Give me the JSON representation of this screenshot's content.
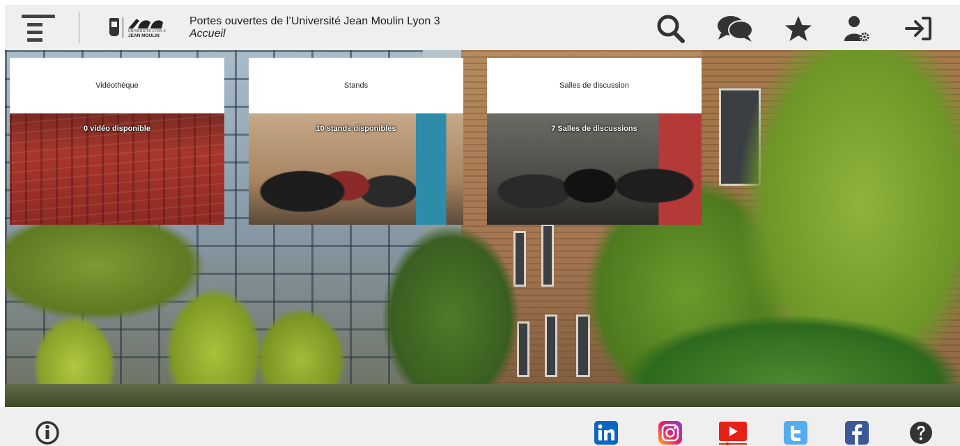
{
  "header": {
    "title": "Portes ouvertes de l’Université Jean Moulin Lyon 3",
    "subtitle": "Accueil",
    "logo": {
      "line1": "UNIVERSITÉ LYON 3",
      "line2": "JEAN MOULIN"
    },
    "icons": [
      "menu-icon",
      "search-icon",
      "chat-icon",
      "star-icon",
      "user-settings-icon",
      "logout-icon"
    ]
  },
  "tiles": [
    {
      "title": "Vidéothèque",
      "caption": "0 vidéo disponible"
    },
    {
      "title": "Stands",
      "caption": "10 stands disponibles"
    },
    {
      "title": "Salles de discussion",
      "caption": "7 Salles de discussions"
    }
  ],
  "footer": {
    "icons": [
      "info-icon",
      "linkedin-icon",
      "instagram-icon",
      "youtube-icon",
      "twitter-icon",
      "facebook-icon",
      "help-icon"
    ]
  },
  "colors": {
    "header_bg": "#efefef",
    "icon_dark": "#333333",
    "linkedin": "#0a66c2",
    "instagram": "#d6249f",
    "youtube": "#e62117",
    "twitter": "#55acee",
    "facebook": "#3b5998"
  }
}
